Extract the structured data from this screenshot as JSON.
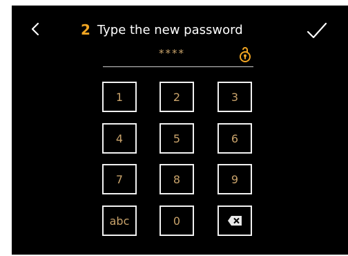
{
  "header": {
    "step": "2",
    "title": "Type the new password"
  },
  "password_field": {
    "masked_value": "****"
  },
  "keypad": {
    "key_1": "1",
    "key_2": "2",
    "key_3": "3",
    "key_4": "4",
    "key_5": "5",
    "key_6": "6",
    "key_7": "7",
    "key_8": "8",
    "key_9": "9",
    "key_abc": "abc",
    "key_0": "0"
  },
  "icons": {
    "back": "chevron-left-icon",
    "confirm": "checkmark-icon",
    "reveal": "key-lock-icon",
    "backspace": "backspace-icon"
  },
  "colors": {
    "background": "#000000",
    "accent": "#f2a623",
    "key_text": "#c9a36b",
    "key_border": "#f2f2f2",
    "title_text": "#ffffff"
  }
}
